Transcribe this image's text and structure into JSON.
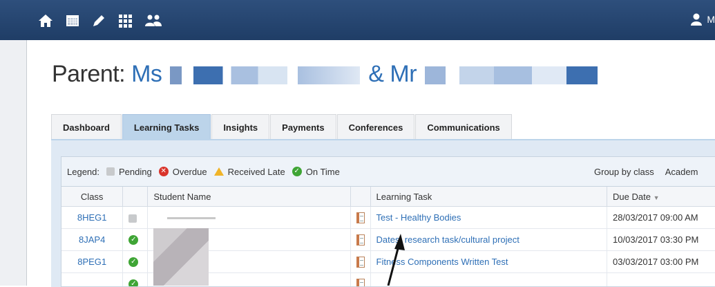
{
  "topbar": {
    "icons": [
      "home-icon",
      "calendar-icon",
      "pencil-icon",
      "grid-icon",
      "people-icon"
    ],
    "user_initial": "M"
  },
  "page": {
    "title_prefix": "Parent:",
    "title_ms": "Ms",
    "title_amp": "& Mr"
  },
  "tabs": [
    {
      "label": "Dashboard",
      "active": false
    },
    {
      "label": "Learning Tasks",
      "active": true
    },
    {
      "label": "Insights",
      "active": false
    },
    {
      "label": "Payments",
      "active": false
    },
    {
      "label": "Conferences",
      "active": false
    },
    {
      "label": "Communications",
      "active": false
    }
  ],
  "legend": {
    "label": "Legend:",
    "pending": "Pending",
    "overdue": "Overdue",
    "received_late": "Received Late",
    "on_time": "On Time",
    "group_by": "Group by class",
    "academic": "Academ"
  },
  "table": {
    "headers": {
      "class": "Class",
      "student": "Student Name",
      "task": "Learning Task",
      "due": "Due Date"
    },
    "rows": [
      {
        "class": "8HEG1",
        "status": "pending",
        "task": "Test - Healthy Bodies",
        "due": "28/03/2017 09:00 AM"
      },
      {
        "class": "8JAP4",
        "status": "on-time",
        "task": "Dates: research task/cultural project",
        "due": "10/03/2017 03:30 PM"
      },
      {
        "class": "8PEG1",
        "status": "on-time",
        "task": "Fitness Components Written Test",
        "due": "03/03/2017 03:00 PM"
      },
      {
        "class": "",
        "status": "on-time",
        "task": "",
        "due": ""
      }
    ]
  },
  "colors": {
    "topbar": "#1f3d66",
    "active_tab": "#bcd4ea",
    "link": "#2e6fb6"
  }
}
